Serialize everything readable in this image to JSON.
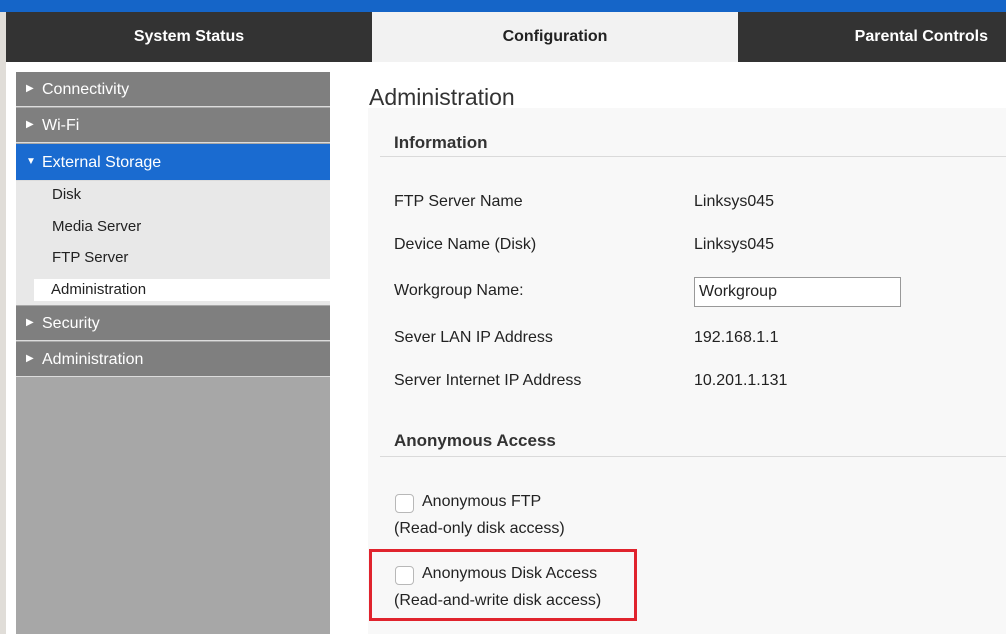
{
  "tabs": [
    {
      "label": "System Status"
    },
    {
      "label": "Configuration"
    },
    {
      "label": "Parental Controls"
    }
  ],
  "sidebar": {
    "items": [
      {
        "label": "Connectivity",
        "arrow": "▶"
      },
      {
        "label": "Wi-Fi",
        "arrow": "▶"
      },
      {
        "label": "External Storage",
        "arrow": "▼"
      },
      {
        "label": "Security",
        "arrow": "▶"
      },
      {
        "label": "Administration",
        "arrow": "▶"
      }
    ],
    "sub_items": [
      {
        "label": "Disk"
      },
      {
        "label": "Media Server"
      },
      {
        "label": "FTP Server"
      },
      {
        "label": "Administration"
      }
    ]
  },
  "main": {
    "title": "Administration",
    "info_heading": "Information",
    "rows": [
      {
        "label": "FTP Server Name",
        "value": "Linksys045"
      },
      {
        "label": "Device Name (Disk)",
        "value": "Linksys045"
      },
      {
        "label": "Workgroup Name:",
        "value": ""
      },
      {
        "label": "Sever LAN IP Address",
        "value": "192.168.1.1"
      },
      {
        "label": "Server Internet IP Address",
        "value": "10.201.1.131"
      }
    ],
    "workgroup_value": "Workgroup",
    "anon_heading": "Anonymous Access",
    "anon_ftp": {
      "label": "Anonymous FTP",
      "note": "(Read-only disk access)",
      "checked": false
    },
    "anon_disk": {
      "label": "Anonymous Disk Access",
      "note": "(Read-and-write disk access)",
      "checked": false
    }
  },
  "colors": {
    "accent": "#1a6bd0",
    "highlight": "#e0232d",
    "tabbar": "#333333"
  }
}
